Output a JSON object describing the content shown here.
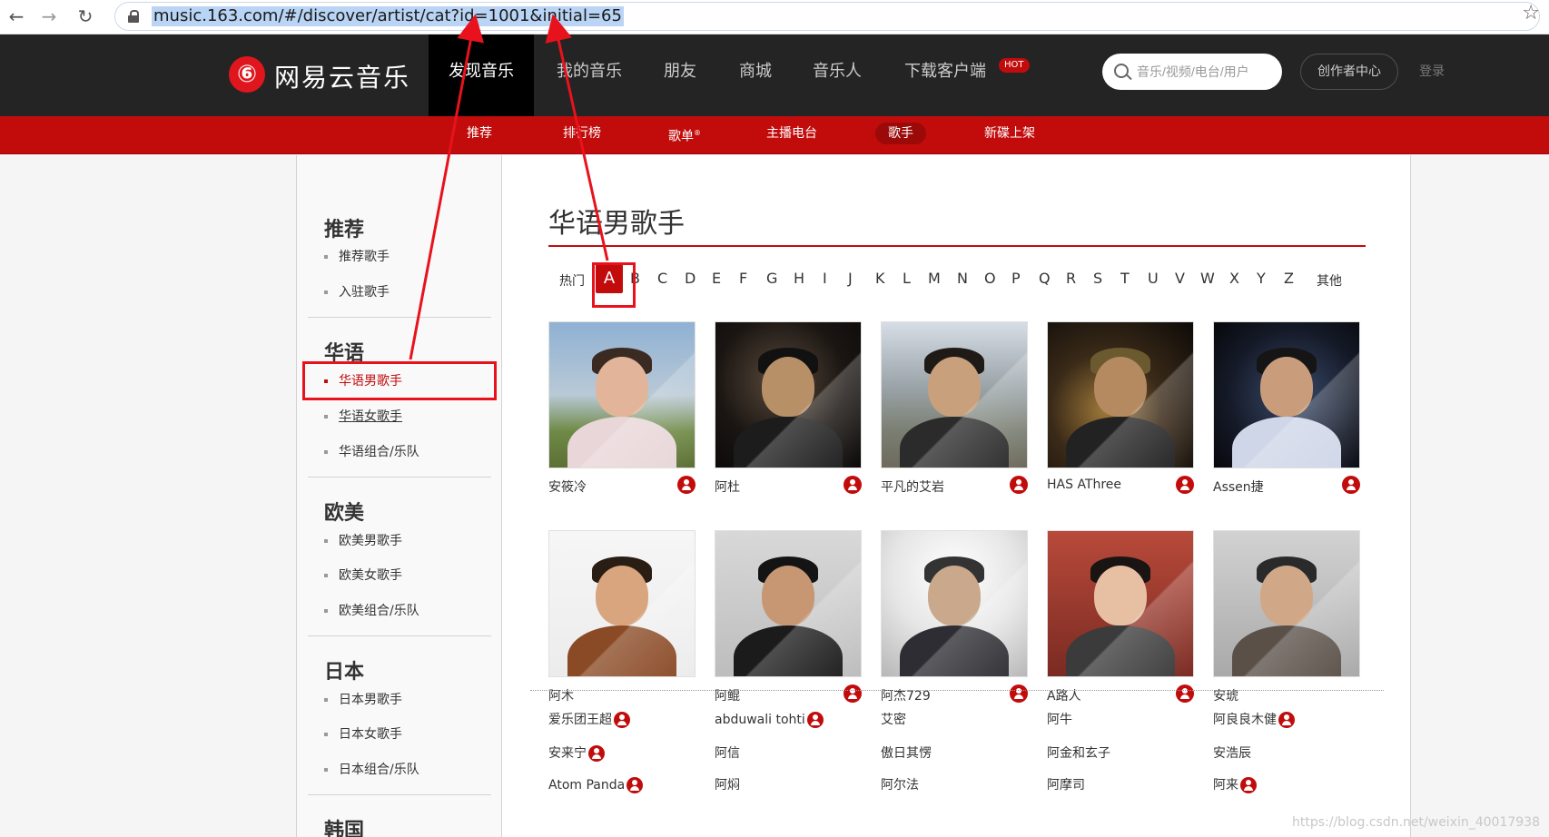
{
  "browser": {
    "url": "music.163.com/#/discover/artist/cat?id=1001&initial=65",
    "back_label": "←",
    "forward_label": "→",
    "reload_label": "↻",
    "star_label": "☆"
  },
  "header": {
    "logo_text": "网易云音乐",
    "logo_glyph": "⑥",
    "nav": [
      "发现音乐",
      "我的音乐",
      "朋友",
      "商城",
      "音乐人",
      "下载客户端"
    ],
    "active_nav": "发现音乐",
    "hot_badge": "HOT",
    "search_placeholder": "音乐/视频/电台/用户",
    "creator_center": "创作者中心",
    "login": "登录"
  },
  "subnav": {
    "items": [
      "推荐",
      "排行榜",
      "歌单",
      "主播电台",
      "歌手",
      "新碟上架"
    ],
    "registered_mark": "®",
    "active": "歌手"
  },
  "sidebar": {
    "groups": [
      {
        "title": "推荐",
        "items": [
          "推荐歌手",
          "入驻歌手"
        ]
      },
      {
        "title": "华语",
        "items": [
          "华语男歌手",
          "华语女歌手",
          "华语组合/乐队"
        ]
      },
      {
        "title": "欧美",
        "items": [
          "欧美男歌手",
          "欧美女歌手",
          "欧美组合/乐队"
        ]
      },
      {
        "title": "日本",
        "items": [
          "日本男歌手",
          "日本女歌手",
          "日本组合/乐队"
        ]
      },
      {
        "title": "韩国",
        "items": []
      }
    ],
    "active_item": "华语男歌手"
  },
  "content": {
    "title": "华语男歌手",
    "hot_label": "热门",
    "letters": [
      "A",
      "B",
      "C",
      "D",
      "E",
      "F",
      "G",
      "H",
      "I",
      "J",
      "K",
      "L",
      "M",
      "N",
      "O",
      "P",
      "Q",
      "R",
      "S",
      "T",
      "U",
      "V",
      "W",
      "X",
      "Y",
      "Z"
    ],
    "other_label": "其他",
    "active_letter": "A",
    "artists": [
      {
        "name": "安筱冷",
        "verified": true
      },
      {
        "name": "阿杜",
        "verified": true
      },
      {
        "name": "平凡的艾岩",
        "verified": true
      },
      {
        "name": "HAS AThree",
        "verified": true
      },
      {
        "name": "Assen捷",
        "verified": true
      },
      {
        "name": "阿木",
        "verified": false
      },
      {
        "name": "阿鲲",
        "verified": true
      },
      {
        "name": "阿杰729",
        "verified": true
      },
      {
        "name": "A路人",
        "verified": true
      },
      {
        "name": "安琥",
        "verified": false
      }
    ],
    "text_list": [
      {
        "name": "爱乐团王超",
        "verified": true
      },
      {
        "name": "abduwali tohti",
        "verified": true
      },
      {
        "name": "艾密",
        "verified": false
      },
      {
        "name": "阿牛",
        "verified": false
      },
      {
        "name": "阿良良木健",
        "verified": true
      },
      {
        "name": "安来宁",
        "verified": true
      },
      {
        "name": "阿信",
        "verified": false
      },
      {
        "name": "傲日其愣",
        "verified": false
      },
      {
        "name": "阿金和玄子",
        "verified": false
      },
      {
        "name": "安浩辰",
        "verified": false
      },
      {
        "name": "Atom Panda",
        "verified": true
      },
      {
        "name": "阿焖",
        "verified": false
      },
      {
        "name": "阿尔法",
        "verified": false
      },
      {
        "name": "阿摩司",
        "verified": false
      },
      {
        "name": "阿来",
        "verified": true
      }
    ]
  },
  "watermark": "https://blog.csdn.net/weixin_40017938",
  "colors": {
    "brand_red": "#c20c0c",
    "topbar": "#242424",
    "annotation": "#e8121c"
  }
}
